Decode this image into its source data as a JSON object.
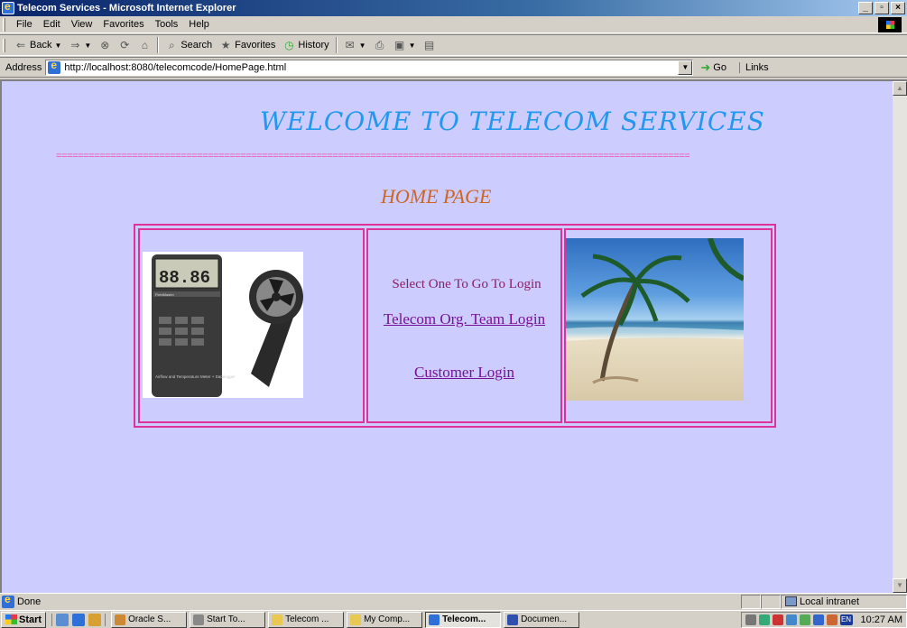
{
  "window": {
    "title": "Telecom Services - Microsoft Internet Explorer",
    "minimize": "_",
    "maximize": "▫",
    "close": "×"
  },
  "menu": {
    "items": [
      "File",
      "Edit",
      "View",
      "Favorites",
      "Tools",
      "Help"
    ]
  },
  "toolbar": {
    "back": "Back",
    "search": "Search",
    "favorites": "Favorites",
    "history": "History"
  },
  "address": {
    "label": "Address",
    "url": "http://localhost:8080/telecomcode/HomePage.html",
    "go": "Go",
    "links": "Links"
  },
  "page": {
    "welcome": "WELCOME TO TELECOM SERVICES",
    "divider": "=====================================================================================================================",
    "home_title": "HOME PAGE",
    "select_text": "Select One To Go To Login",
    "team_login": "Telecom Org. Team Login",
    "customer_login": "Customer Login"
  },
  "meter": {
    "display": "88.86",
    "brand": "FieldMaster",
    "caption": "Airflow and Temperature Meter + Datalogger"
  },
  "status": {
    "text": "Done",
    "zone": "Local intranet"
  },
  "taskbar": {
    "start": "Start",
    "tasks": [
      "Oracle S...",
      "Start To...",
      "Telecom ...",
      "My Comp...",
      "Telecom...",
      "Documen..."
    ],
    "clock": "10:27 AM",
    "lang": "EN"
  },
  "colors": {
    "page_bg": "#ccccff",
    "welcome": "#2299ee",
    "divider": "#ff44aa",
    "home_title": "#cc6622",
    "table_border": "#dd3399",
    "link": "#771199"
  }
}
